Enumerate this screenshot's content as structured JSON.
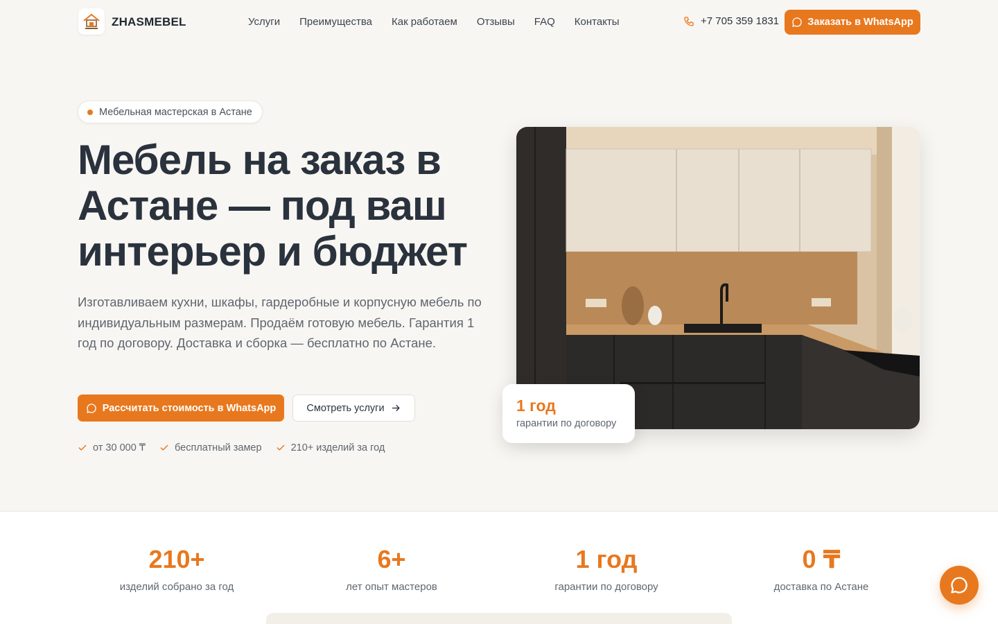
{
  "header": {
    "brand": "ZHASMEBEL",
    "nav": [
      "Услуги",
      "Преимущества",
      "Как работаем",
      "Отзывы",
      "FAQ",
      "Контакты"
    ],
    "phone": "+7 705 359 1831",
    "cta": "Заказать в WhatsApp"
  },
  "hero": {
    "pill": "Мебельная мастерская в Астане",
    "title": "Мебель на заказ в Астане — под ваш интерьер и бюджет",
    "lead": "Изготавливаем кухни, шкафы, гардеробные и корпусную мебель по индивидуальным размерам. Продаём готовую мебель. Гарантия 1 год по договору. Доставка и сборка — бесплатно по Астане.",
    "btn_primary": "Рассчитать стоимость в WhatsApp",
    "btn_secondary": "Смотреть услуги",
    "checks": [
      "от 30 000 ₸",
      "бесплатный замер",
      "210+ изделий за год"
    ],
    "badge_big": "1 год",
    "badge_small": "гарантии по договору"
  },
  "stats": [
    {
      "num": "210+",
      "label": "изделий собрано за год"
    },
    {
      "num": "6+",
      "label": "лет опыт мастеров"
    },
    {
      "num": "1 год",
      "label": "гарантии по договору"
    },
    {
      "num": "0 ₸",
      "label": "доставка по Астане"
    }
  ],
  "colors": {
    "accent": "#e8781e",
    "text": "#2a323d",
    "bg": "#f8f6f2"
  }
}
